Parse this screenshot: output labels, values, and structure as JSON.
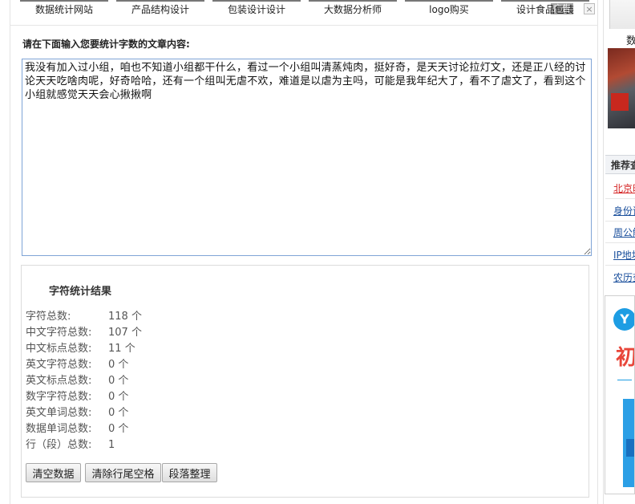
{
  "ad_strip": {
    "tabs": [
      "数据统计网站",
      "产品结构设计",
      "包装设计设计",
      "大数据分析师",
      "logo购买",
      "设计食品包装"
    ],
    "ad_mark": "广告",
    "close": "×"
  },
  "form": {
    "prompt": "请在下面输入您要统计字数的文章内容:",
    "content": "我没有加入过小组，咱也不知道小组都干什么，看过一个小组叫清蒸炖肉，挺好奇，是天天讨论拉灯文，还是正八经的讨论天天吃啥肉呢，好奇哈哈，还有一个组叫无虐不欢，难道是以虐为主吗，可能是我年纪大了，看不了虐文了，看到这个小组就感觉天天会心揪揪啊"
  },
  "result": {
    "title": "字符统计结果",
    "unit": "个",
    "stats": [
      {
        "label": "字符总数:",
        "value": "118"
      },
      {
        "label": "中文字符总数:",
        "value": "107"
      },
      {
        "label": "中文标点总数:",
        "value": "11"
      },
      {
        "label": "英文字符总数:",
        "value": "0"
      },
      {
        "label": "英文标点总数:",
        "value": "0"
      },
      {
        "label": "数字字符总数:",
        "value": "0"
      },
      {
        "label": "英文单词总数:",
        "value": "0"
      },
      {
        "label": "数据单词总数:",
        "value": "0"
      },
      {
        "label": "行（段）总数:",
        "value": "1"
      }
    ],
    "buttons": [
      "清空数据",
      "清除行尾空格",
      "段落整理"
    ]
  },
  "sidebar": {
    "top_char": "数",
    "panel_head": "推荐查",
    "links": [
      {
        "label": "北京时",
        "color": "#d42020"
      },
      {
        "label": "身份证",
        "color": "#1a4f9c"
      },
      {
        "label": "周公解",
        "color": "#1a4f9c"
      },
      {
        "label": "IP地址",
        "color": "#1a4f9c"
      },
      {
        "label": "农历查",
        "color": "#1a4f9c"
      }
    ],
    "ad_logo": "Y",
    "ad_big": "初"
  },
  "colors": {
    "textarea_border": "#7fa4d6",
    "link_red": "#d42020",
    "link_blue": "#1a4f9c",
    "ad_blue": "#1d9de3",
    "ad_red": "#e8463a"
  }
}
